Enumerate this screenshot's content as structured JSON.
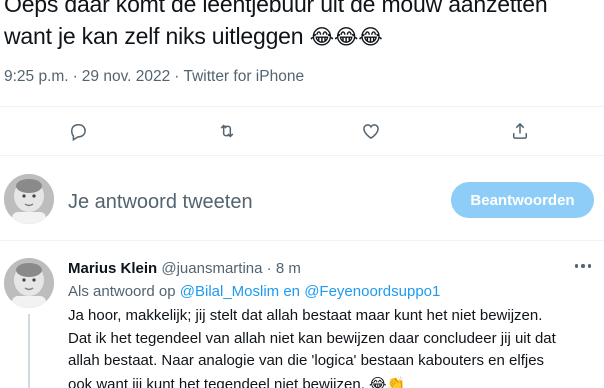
{
  "tweet": {
    "text_line1": "Oeps daar komt de leentjebuur uit de mouw aanzetten",
    "text_line2": "want je kan zelf niks uitleggen",
    "emojis": "😂😂😂",
    "time": "9:25 p.m.",
    "separator": "·",
    "date": "29 nov. 2022",
    "source": "Twitter for iPhone"
  },
  "actions": {
    "reply_icon": "reply-icon",
    "retweet_icon": "retweet-icon",
    "like_icon": "like-icon",
    "share_icon": "share-icon"
  },
  "composer": {
    "placeholder": "Je antwoord tweeten",
    "button_label": "Beantwoorden"
  },
  "reply": {
    "name": "Marius Klein",
    "handle": "@juansmartina",
    "dot": "·",
    "time": "8 m",
    "replying_prefix": "Als antwoord op",
    "mention1": "@Bilal_Moslim",
    "conjunction": "en",
    "mention2": "@Feyenoordsuppo1",
    "body_line1": "Ja hoor, makkelijk; jij stelt dat allah bestaat maar kunt het niet bewijzen.",
    "body_line2": "Dat ik het tegendeel van allah niet kan bewijzen daar concludeer jij uit dat",
    "body_line3": "allah bestaat. Naar analogie van die 'logica' bestaan kabouters en elfjes",
    "body_line4": "ook want jij kunt het tegendeel niet bewijzen.",
    "body_emojis": "😂👏"
  },
  "colors": {
    "accent": "#1d9bf0",
    "button_disabled": "#8ecdf8",
    "muted_text": "#536471",
    "divider": "#eff3f4"
  }
}
